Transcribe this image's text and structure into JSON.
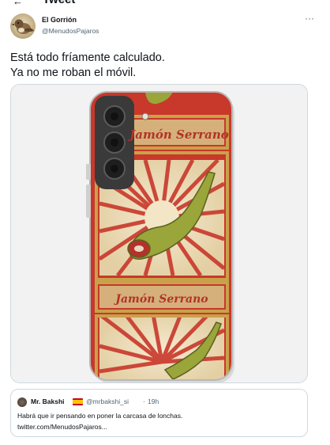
{
  "header": {
    "title": "Tweet",
    "back_icon": "arrow-left-icon"
  },
  "author": {
    "name": "El Gorrión",
    "handle": "@MenudosPajaros",
    "more_icon": "more-icon"
  },
  "tweet": {
    "line1": "Está todo fríamente calculado.",
    "line2": "Ya no me roban el móvil."
  },
  "media": {
    "brand_top": "Jamón Serrano",
    "brand_bottom": "Jamón Serrano",
    "colors": {
      "red": "#c8382b",
      "cream": "#efe1c0",
      "gold": "#c9a14a",
      "green": "#9aa53a",
      "camera": "#3a3a3a"
    }
  },
  "quote": {
    "name": "Mr. Bakshi",
    "flag": "spain-flag-icon",
    "handle": "@mrbakshi_si",
    "separator": "·",
    "time": "19h",
    "text_line1": "Habrá que ir pensando en poner la carcasa de lonchas.",
    "text_line2": "twitter.com/MenudosPajaros..."
  }
}
